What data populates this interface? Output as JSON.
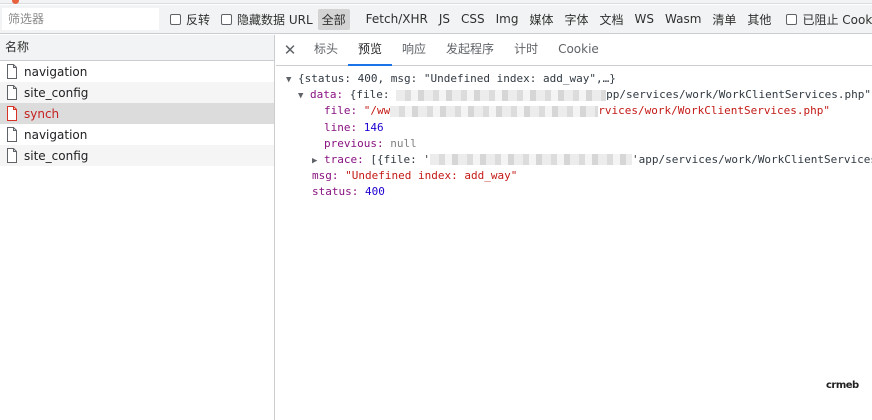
{
  "filter": {
    "placeholder": "筛选器",
    "invert_label": "反转",
    "hide_data_url_label": "隐藏数据 URL",
    "types": [
      "全部",
      "Fetch/XHR",
      "JS",
      "CSS",
      "Img",
      "媒体",
      "字体",
      "文档",
      "WS",
      "Wasm",
      "清单",
      "其他"
    ],
    "blocked_cookies_label": "已阻止 Cookie"
  },
  "requests": {
    "column_header": "名称",
    "items": [
      {
        "name": "navigation"
      },
      {
        "name": "site_config"
      },
      {
        "name": "synch"
      },
      {
        "name": "navigation"
      },
      {
        "name": "site_config"
      }
    ]
  },
  "tabs": {
    "close_glyph": "✕",
    "items": [
      "标头",
      "预览",
      "响应",
      "发起程序",
      "计时",
      "Cookie"
    ]
  },
  "preview": {
    "summary": "{status: 400, msg: \"Undefined index: add_way\",…}",
    "data_key": "data:",
    "data_open": "{file:",
    "data_file_tail": "pp/services/work/WorkClientServices.php\"",
    "file_key": "file:",
    "file_head": "\"/ww",
    "file_tail": "rvices/work/WorkClientServices.php\"",
    "line_key": "line:",
    "line_value": "146",
    "previous_key": "previous:",
    "previous_value": "null",
    "trace_key": "trace:",
    "trace_open": "[{file: '",
    "trace_tail": "'app/services/work/WorkClientServices",
    "msg_key": "msg:",
    "msg_value": "\"Undefined index: add_way\"",
    "status_key": "status:",
    "status_value": "400"
  },
  "watermark": "crmeb",
  "colors": {
    "key": "#881280",
    "string": "#c41a16",
    "number": "#1c00cf",
    "selected_row_text": "#c5221f",
    "active_tab_underline": "#1a73e8"
  }
}
